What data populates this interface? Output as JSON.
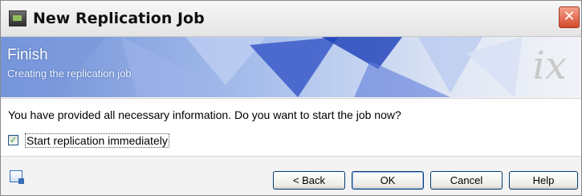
{
  "window": {
    "title": "New Replication Job",
    "close_glyph": "✕"
  },
  "banner": {
    "title": "Finish",
    "subtitle": "Creating the replication job",
    "logo": "ix"
  },
  "content": {
    "message": "You have provided all necessary information. Do you want to start the job now?",
    "checkbox": {
      "label": "Start replication immediately",
      "checked": true
    }
  },
  "footer": {
    "buttons": {
      "back": "< Back",
      "ok": "OK",
      "cancel": "Cancel",
      "help": "Help"
    }
  }
}
